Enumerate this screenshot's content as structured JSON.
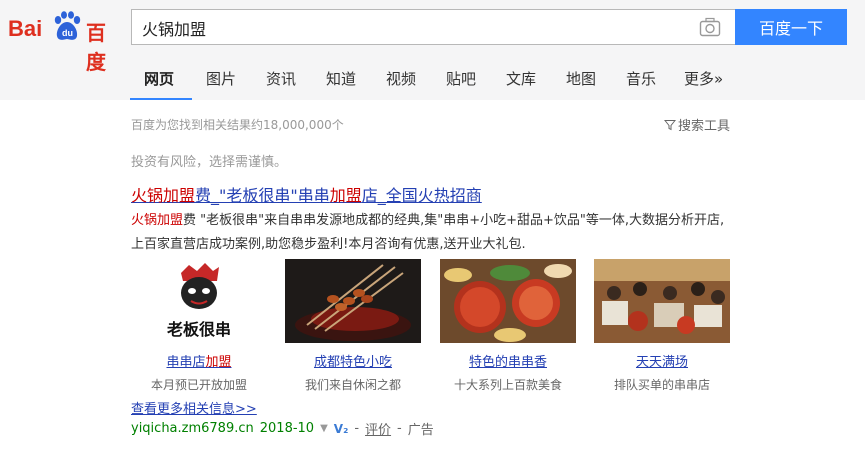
{
  "logo": {
    "bai": "Bai",
    "du": "du",
    "cn": "百度"
  },
  "search": {
    "value": "火锅加盟",
    "button": "百度一下"
  },
  "tabs": [
    "网页",
    "图片",
    "资讯",
    "知道",
    "视频",
    "贴吧",
    "文库",
    "地图",
    "音乐",
    "更多»"
  ],
  "stats": "百度为您找到相关结果约18,000,000个",
  "tools": "搜索工具",
  "risk": "投资有风险，选择需谨慎。",
  "result": {
    "title": {
      "p1": "火锅加盟",
      "p2": "费_\"老板很串\"串串",
      "p3": "加盟",
      "p4": "店_全国火热招商"
    },
    "desc": {
      "hl": "火锅加盟",
      "rest": "费 \"老板很串\"来自串串发源地成都的经典,集\"串串+小吃+甜品+饮品\"等一体,大数据分析开店,上百家直营店成功案例,助您稳步盈利!本月咨询有优惠,送开业大礼包."
    },
    "thumbs": [
      {
        "caption_a": "串串店",
        "caption_b": "加盟",
        "sub": "本月预已开放加盟",
        "logo_text": "老板很串"
      },
      {
        "caption_a": "成都特色小吃",
        "caption_b": "",
        "sub": "我们来自休闲之都"
      },
      {
        "caption_a": "特色的串串香",
        "caption_b": "",
        "sub": "十大系列上百款美食"
      },
      {
        "caption_a": "天天满场",
        "caption_b": "",
        "sub": "排队买单的串串店"
      }
    ],
    "more": "查看更多相关信息>>",
    "url": "yiqicha.zm6789.cn",
    "date": "2018-10",
    "v2": "V₂",
    "sep1": "-",
    "eval": "评价",
    "sep2": "-",
    "ad": "广告"
  }
}
